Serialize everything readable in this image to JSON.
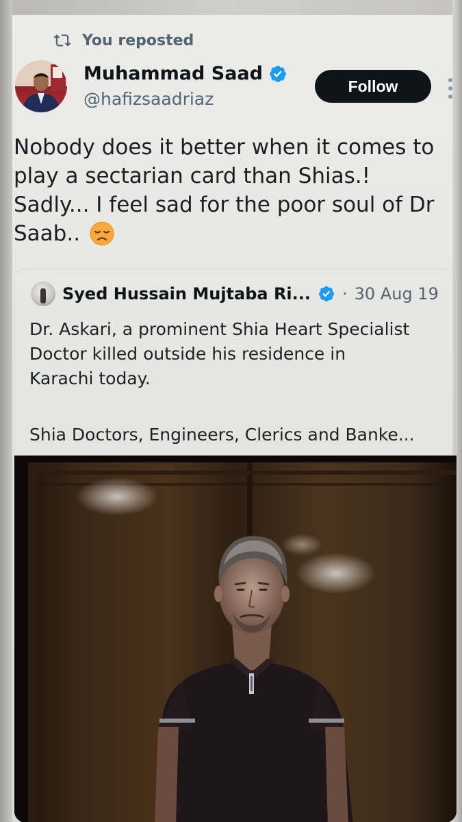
{
  "repost": {
    "label": "You reposted",
    "icon": "repost-icon"
  },
  "author": {
    "name": "Muhammad Saad",
    "handle": "@hafizsaadriaz",
    "verified": true,
    "follow_label": "Follow"
  },
  "tweet": {
    "text": "Nobody does it better when it comes to\nplay a sectarian card than Shias.!\nSadly... I feel sad for the poor soul of Dr\nSaab.. ",
    "emoji": "disappointed-face"
  },
  "quote": {
    "name": "Syed Hussain Mujtaba Ri...",
    "verified": true,
    "separator": "·",
    "date": "30 Aug 19",
    "text": "Dr. Askari, a prominent Shia Heart Specialist\nDoctor killed outside his residence in\nKarachi today.",
    "text_more": "Shia Doctors, Engineers, Clerics and Banke...",
    "media": "photo of a man in dark polo shirt standing before wooden wall"
  },
  "colors": {
    "text_primary": "#0f1419",
    "text_secondary": "#536471",
    "verified_blue": "#1d9bf0",
    "follow_bg": "#0f1419",
    "border": "#cfd9de"
  }
}
